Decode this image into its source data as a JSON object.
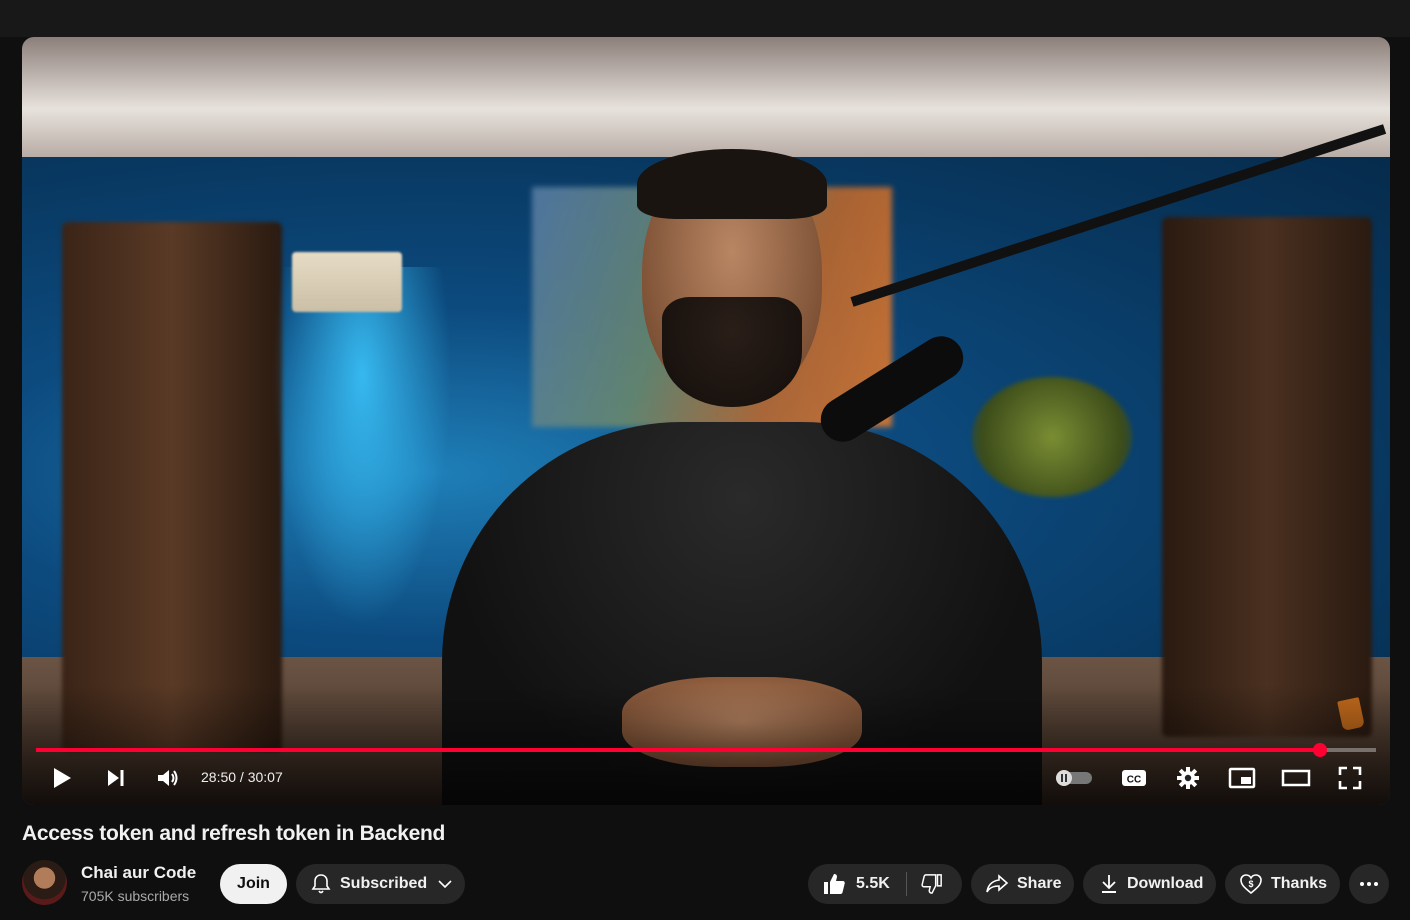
{
  "player": {
    "time_display": "28:50 / 30:07",
    "progress": 0.958,
    "accent_color": "#ff0033"
  },
  "video": {
    "title": "Access token and refresh token in Backend"
  },
  "channel": {
    "name": "Chai aur Code",
    "subscribers": "705K subscribers"
  },
  "actions": {
    "join_label": "Join",
    "subscribed_label": "Subscribed",
    "like_count": "5.5K",
    "share_label": "Share",
    "download_label": "Download",
    "thanks_label": "Thanks"
  },
  "icons": {
    "play": "play-icon",
    "next": "next-icon",
    "volume": "volume-icon",
    "autoplay": "autoplay-toggle-icon",
    "captions": "captions-icon",
    "settings": "gear-icon",
    "miniplayer": "miniplayer-icon",
    "theater": "theater-icon",
    "fullscreen": "fullscreen-icon",
    "bell": "bell-icon",
    "like": "thumbs-up-icon",
    "dislike": "thumbs-down-icon",
    "share": "share-icon",
    "download": "download-icon",
    "thanks": "heart-dollar-icon",
    "more": "more-icon"
  }
}
